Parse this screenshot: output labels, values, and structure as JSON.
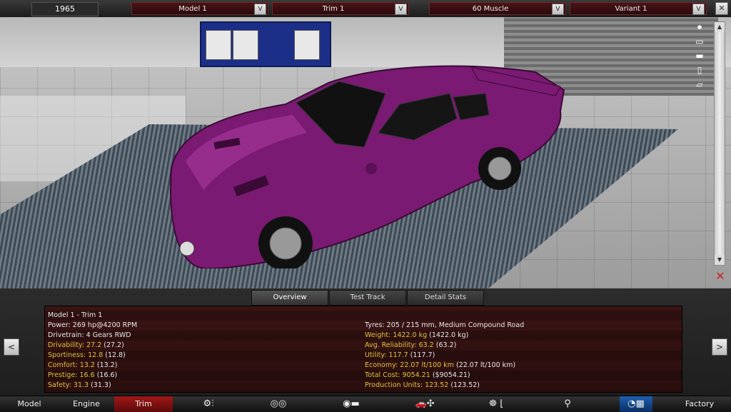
{
  "topbar": {
    "year": "1965",
    "model": "Model 1",
    "trim": "Trim 1",
    "body": "60 Muscle",
    "variant": "Variant 1",
    "dropdown_button": "V",
    "close": "✕"
  },
  "viewport": {
    "car_color": "#7a1a72",
    "scroll_up": "▲",
    "scroll_down": "▼",
    "reset_icon": "✕"
  },
  "tabs": [
    "Overview",
    "Test Track",
    "Detail Stats"
  ],
  "stats": {
    "header": "Model 1 - Trim 1",
    "left": [
      {
        "label": "Power: ",
        "value": "269 hp@4200 RPM",
        "highlight": false
      },
      {
        "label": "Drivetrain: ",
        "value": "4 Gears RWD",
        "highlight": false
      },
      {
        "label": "Drivability: 27.2",
        "value": " (27.2)",
        "highlight": true
      },
      {
        "label": "Sportiness: 12.8",
        "value": " (12.8)",
        "highlight": true
      },
      {
        "label": "Comfort: 13.2",
        "value": " (13.2)",
        "highlight": true
      },
      {
        "label": "Prestige: 16.6",
        "value": " (16.6)",
        "highlight": true
      },
      {
        "label": "Safety: 31.3",
        "value": " (31.3)",
        "highlight": true
      }
    ],
    "right": [
      {
        "label": "Tyres: ",
        "value": "205 / 215 mm, Medium Compound Road",
        "highlight": false
      },
      {
        "label": "Weight: 1422.0 kg",
        "value": " (1422.0 kg)",
        "highlight": true
      },
      {
        "label": "Avg. Reliability: 63.2",
        "value": " (63.2)",
        "highlight": true
      },
      {
        "label": "Utility: 117.7",
        "value": " (117.7)",
        "highlight": true
      },
      {
        "label": "Economy: 22.07 lt/100 km",
        "value": " (22.07 lt/100 km)",
        "highlight": true
      },
      {
        "label": "Total Cost: 9054.21",
        "value": " ($9054.21)",
        "highlight": true
      },
      {
        "label": "Production Units: 123.52",
        "value": " (123.52)",
        "highlight": true
      }
    ]
  },
  "side_buttons": {
    "prev": "<",
    "next": ">"
  },
  "nav": {
    "model": "Model",
    "engine": "Engine",
    "trim": "Trim",
    "factory": "Factory"
  }
}
